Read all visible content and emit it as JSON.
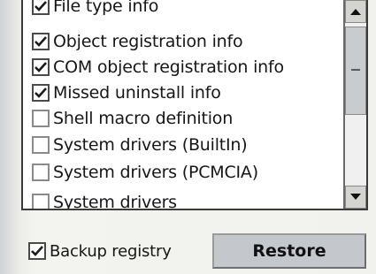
{
  "list": {
    "items": [
      {
        "label": "File type info",
        "checked": true
      },
      {
        "label": "Object registration info",
        "checked": true
      },
      {
        "label": "COM object registration info",
        "checked": true
      },
      {
        "label": "Missed uninstall info",
        "checked": true
      },
      {
        "label": "Shell macro definition",
        "checked": false
      },
      {
        "label": "System drivers (BuiltIn)",
        "checked": false
      },
      {
        "label": "System drivers (PCMCIA)",
        "checked": false
      },
      {
        "label": "System drivers",
        "checked": false
      }
    ]
  },
  "backup": {
    "label": "Backup registry",
    "checked": true
  },
  "restore_label": "Restore",
  "icons": {
    "scroll_up": "arrow-up-icon",
    "scroll_down": "arrow-down-icon",
    "check": "checkmark-icon"
  }
}
